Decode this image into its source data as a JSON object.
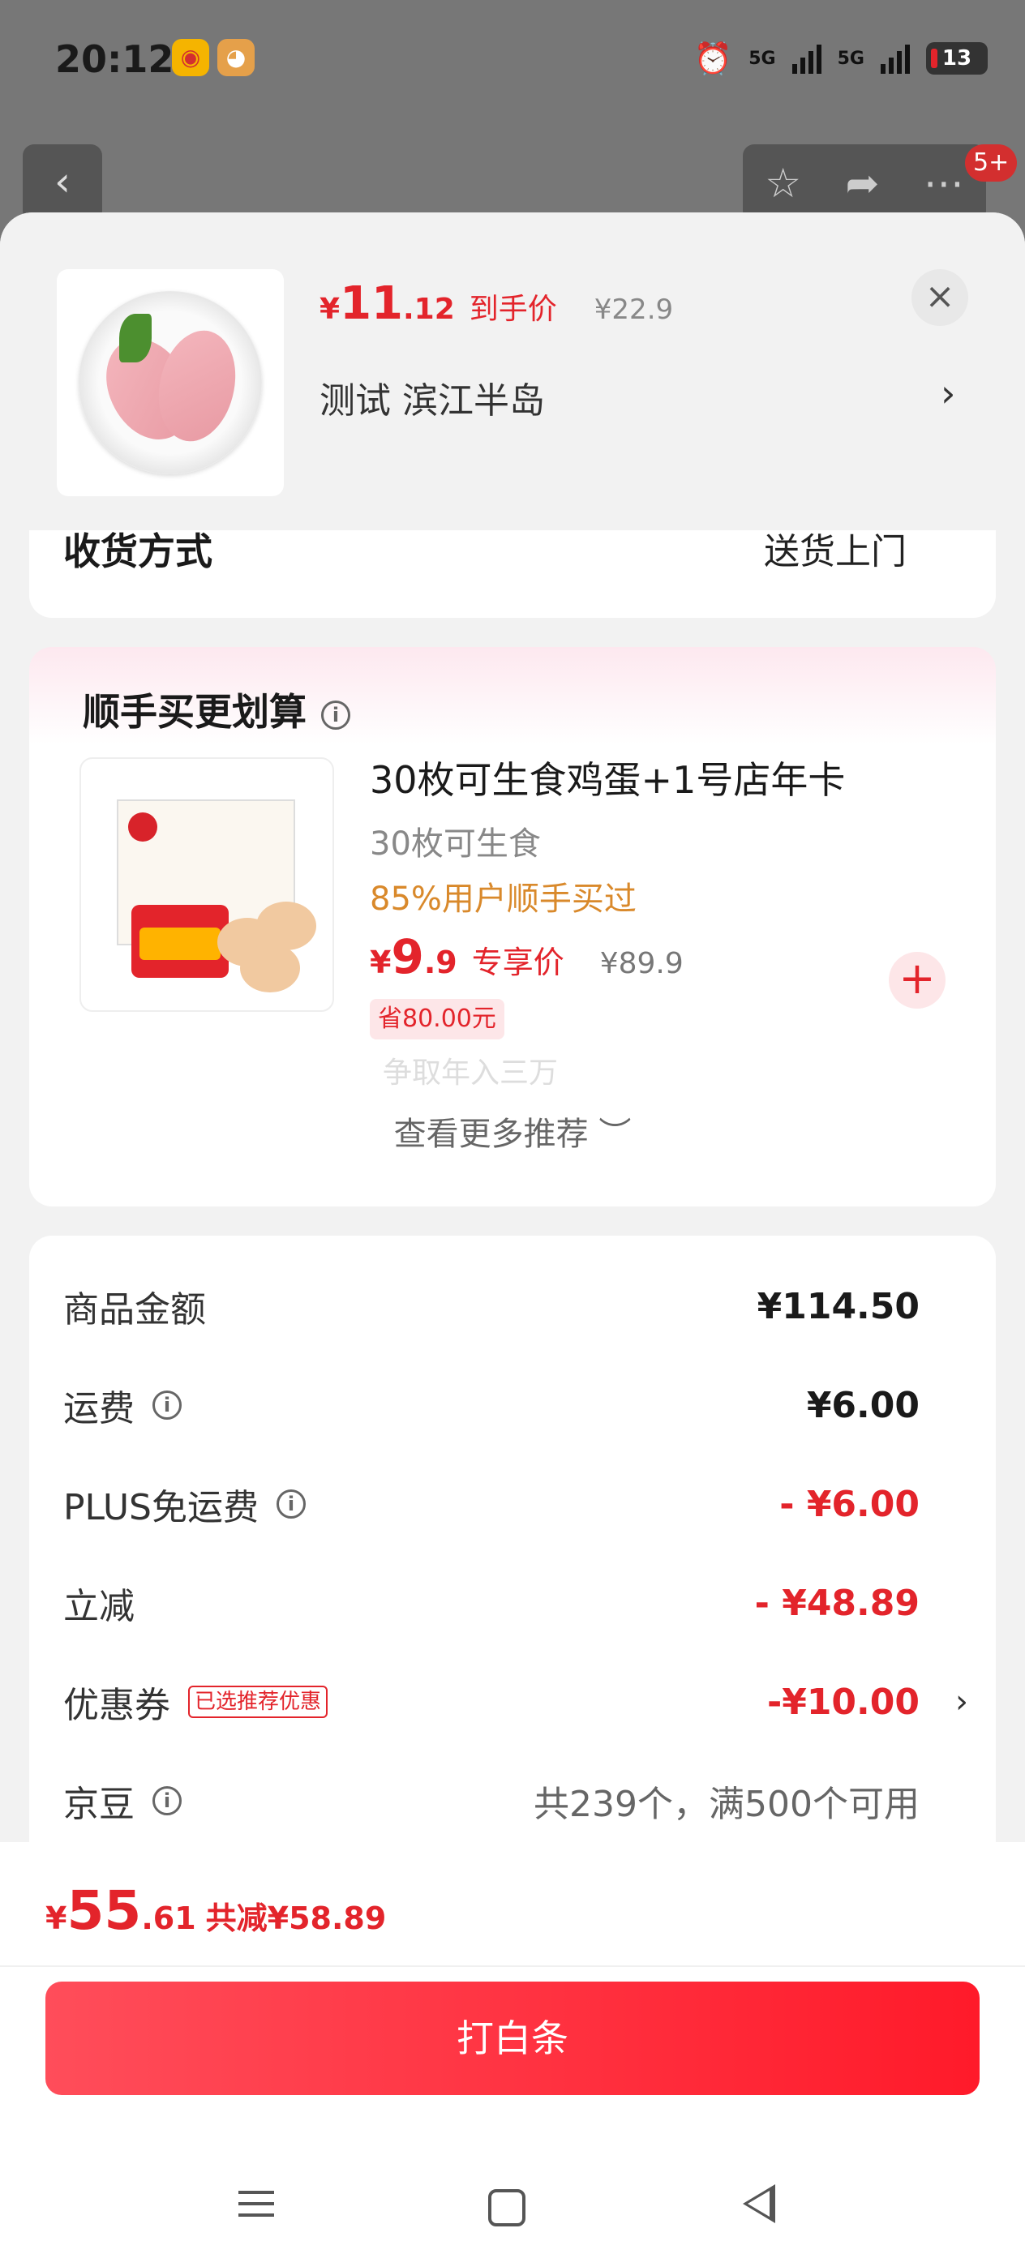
{
  "status_bar": {
    "time": "20:12",
    "signal_1": "5G",
    "signal_2": "5G",
    "battery": "13"
  },
  "background_page": {
    "back_icon": "chevron-left-icon",
    "badge": "5+"
  },
  "header": {
    "price_currency": "¥",
    "price_int": "11",
    "price_dec": ".12",
    "price_tag": "到手价",
    "original_price": "¥22.9",
    "address": "测试 滨江半岛",
    "address_arrow": "›",
    "close": "×"
  },
  "delivery": {
    "label": "收货方式",
    "value": "送货上门"
  },
  "recommend": {
    "title": "顺手买更划算",
    "info": "i",
    "item": {
      "name": "30枚可生食鸡蛋+1号店年卡",
      "subtitle": "30枚可生食",
      "buyers": "85%用户顺手买过",
      "price_currency": "¥",
      "price_int": "9",
      "price_dec": ".9",
      "price_tag": "专享价",
      "original_price": "¥89.9",
      "save": "省80.00元",
      "ghost_text": "争取年入三万",
      "add": "+"
    },
    "more": "查看更多推荐 ︶"
  },
  "fees": [
    {
      "label": "商品金额",
      "info": false,
      "value": "¥114.50",
      "style": "normal"
    },
    {
      "label": "运费",
      "info": true,
      "value": "¥6.00",
      "style": "normal"
    },
    {
      "label": "PLUS免运费",
      "info": true,
      "value": "- ¥6.00",
      "style": "red"
    },
    {
      "label": "立减",
      "info": false,
      "value": "- ¥48.89",
      "style": "red"
    },
    {
      "label": "优惠券",
      "info": false,
      "tag": "已选推荐优惠",
      "value": "-¥10.00",
      "style": "red",
      "arrow": "›"
    },
    {
      "label": "京豆",
      "info": true,
      "value": "共239个，满500个可用",
      "style": "gray"
    }
  ],
  "bottom": {
    "total_currency": "¥",
    "total_int": "55",
    "total_dec": ".61",
    "discount": "共减¥58.89",
    "pay_button": "打白条"
  },
  "colors": {
    "accent": "#e3242b",
    "buyers": "#d9892b"
  }
}
